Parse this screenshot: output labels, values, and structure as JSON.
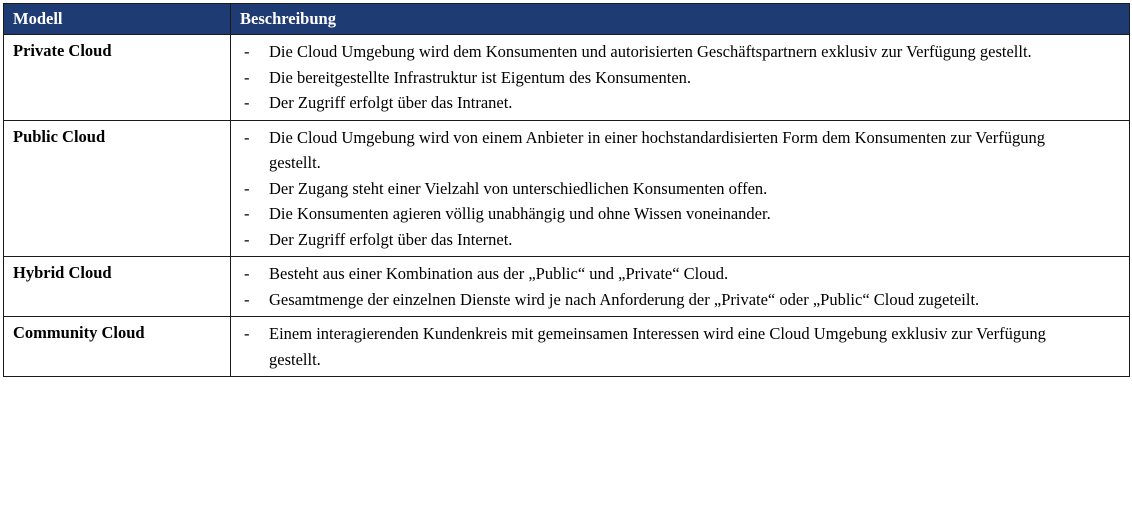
{
  "header": {
    "col_model": "Modell",
    "col_description": "Beschreibung"
  },
  "rows": [
    {
      "model": "Private Cloud",
      "items": [
        "Die Cloud Umgebung wird dem Konsumenten und autorisierten Geschäftspartnern exklusiv zur Verfügung gestellt.",
        "Die bereitgestellte Infrastruktur ist Eigentum des Konsumenten.",
        "Der Zugriff erfolgt über das Intranet."
      ]
    },
    {
      "model": "Public Cloud",
      "items": [
        "Die Cloud Umgebung wird von einem Anbieter in einer hochstandardisierten Form dem Konsumenten zur Verfügung gestellt.",
        "Der Zugang steht einer Vielzahl von unterschiedlichen Konsumenten offen.",
        "Die Konsumenten agieren völlig unabhängig und ohne Wissen voneinander.",
        "Der Zugriff erfolgt über das Internet."
      ]
    },
    {
      "model": "Hybrid Cloud",
      "items": [
        "Besteht aus einer Kombination aus der „Public“ und „Private“ Cloud.",
        "Gesamtmenge der einzelnen Dienste wird je nach Anforderung der „Private“ oder „Public“ Cloud zugeteilt."
      ]
    },
    {
      "model": "Community Cloud",
      "items": [
        "Einem interagierenden Kundenkreis mit gemeinsamen Interessen wird eine Cloud Umgebung exklusiv zur Verfügung gestellt."
      ]
    }
  ],
  "bullet": "-",
  "colors": {
    "header_bg": "#1f3b73",
    "header_text": "#ffffff",
    "border": "#1b1b1b"
  }
}
